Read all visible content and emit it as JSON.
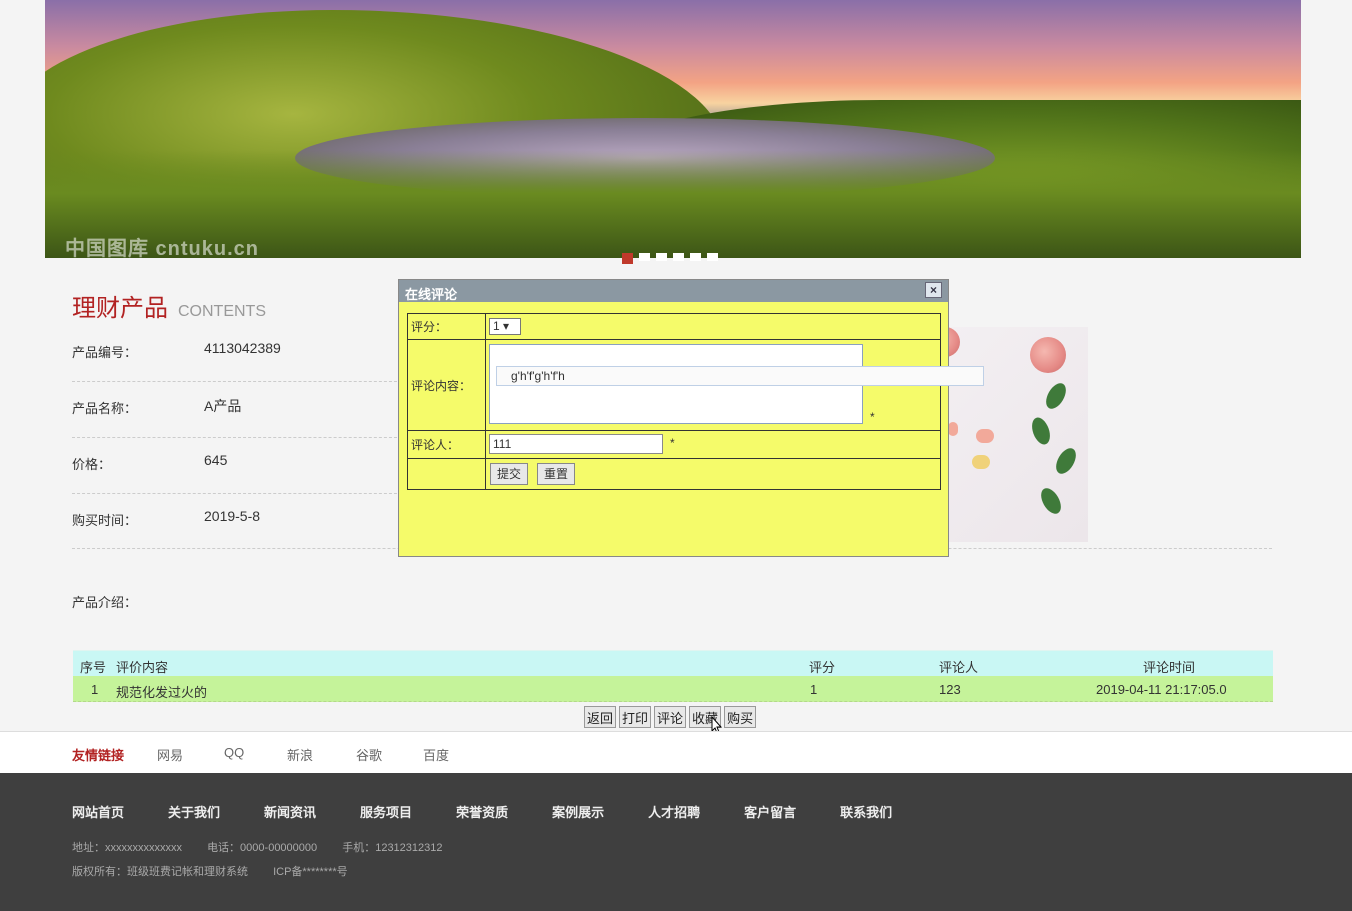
{
  "banner": {
    "watermark": "中国图库 cntuku.cn",
    "dots": 6
  },
  "product": {
    "section_title": "理财产品",
    "section_subtitle": "CONTENTS",
    "fields": [
      {
        "label": "产品编号：",
        "value": "4113042389"
      },
      {
        "label": "产品名称：",
        "value": "A产品"
      },
      {
        "label": "价格：",
        "value": "645"
      },
      {
        "label": "购买时间：",
        "value": "2019-5-8"
      }
    ],
    "intro_label": "产品介绍："
  },
  "reviews": {
    "headers": {
      "index": "序号",
      "content": "评价内容",
      "score": "评分",
      "reviewer": "评论人",
      "time": "评论时间"
    },
    "rows": [
      {
        "index": "1",
        "content": "规范化发过火的",
        "score": "1",
        "reviewer": "123",
        "time": "2019-04-11 21:17:05.0"
      }
    ]
  },
  "actions": {
    "back": "返回",
    "print": "打印",
    "comment": "评论",
    "favorite": "收藏",
    "buy": "购买"
  },
  "friend_links": {
    "title": "友情链接",
    "items": [
      "网易",
      "QQ",
      "新浪",
      "谷歌",
      "百度"
    ]
  },
  "footer": {
    "nav": [
      "网站首页",
      "关于我们",
      "新闻资讯",
      "服务项目",
      "荣誉资质",
      "案例展示",
      "人才招聘",
      "客户留言",
      "联系我们"
    ],
    "address": "地址：xxxxxxxxxxxxxx",
    "phone": "电话：0000-00000000",
    "mobile": "手机：12312312312",
    "copyright": "版权所有：班级班费记帐和理财系统",
    "icp": "ICP备********号"
  },
  "dialog": {
    "title": "在线评论",
    "close": "×",
    "score_label": "评分：",
    "score_value": "1 ▾",
    "content_label": "评论内容：",
    "ime_text": "g'h'f'g'h'f'h",
    "reviewer_label": "评论人：",
    "reviewer_value": "111",
    "required_mark": "*",
    "submit": "提交",
    "reset": "重置"
  }
}
